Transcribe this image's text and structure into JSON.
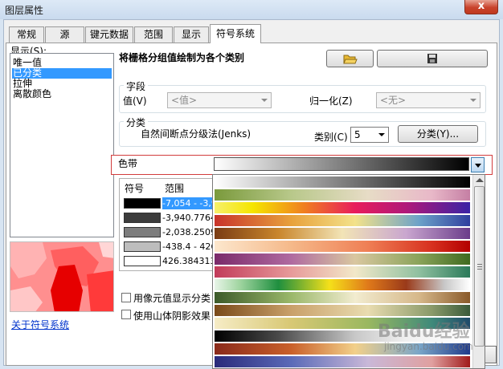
{
  "window": {
    "title": "图层属性",
    "close_label": "x"
  },
  "tabs": [
    {
      "label": "常规"
    },
    {
      "label": "源"
    },
    {
      "label": "键元数据"
    },
    {
      "label": "范围"
    },
    {
      "label": "显示"
    },
    {
      "label": "符号系统"
    }
  ],
  "left": {
    "show_label": "显示(S):",
    "items": [
      "唯一值",
      "已分类",
      "拉伸",
      "离散颜色"
    ],
    "selected": "已分类",
    "about_link": "关于符号系统"
  },
  "header": {
    "title": "将栅格分组值绘制为各个类别"
  },
  "field_group": {
    "label": "字段",
    "value_label": "值(V)",
    "value_combo": "<值>",
    "normalize_label": "归一化(Z)",
    "normalize_combo": "<无>"
  },
  "class_group": {
    "label": "分类",
    "method": "自然间断点分级法(Jenks)",
    "classes_label": "类别(C)",
    "classes_value": "5",
    "classify_button": "分类(Y)..."
  },
  "ramp": {
    "label": "色带"
  },
  "table": {
    "headers": [
      "符号",
      "范围"
    ],
    "rows": [
      {
        "color": "#000000",
        "range": "-7,054 - -3,9"
      },
      {
        "color": "#3c3c3c",
        "range": "-3,940.7764"
      },
      {
        "color": "#7d7d7d",
        "range": "-2,038.2509"
      },
      {
        "color": "#bdbdbd",
        "range": "-438.4 - 426"
      },
      {
        "color": "#ffffff",
        "range": "426.3843137"
      }
    ]
  },
  "options": {
    "use_hillshade_label": "使用山体阴影效果",
    "show_raster_label": "用像元值显示分类"
  },
  "watermark": {
    "main": "Baidu经验",
    "sub": "jingyan.baidu.com"
  }
}
